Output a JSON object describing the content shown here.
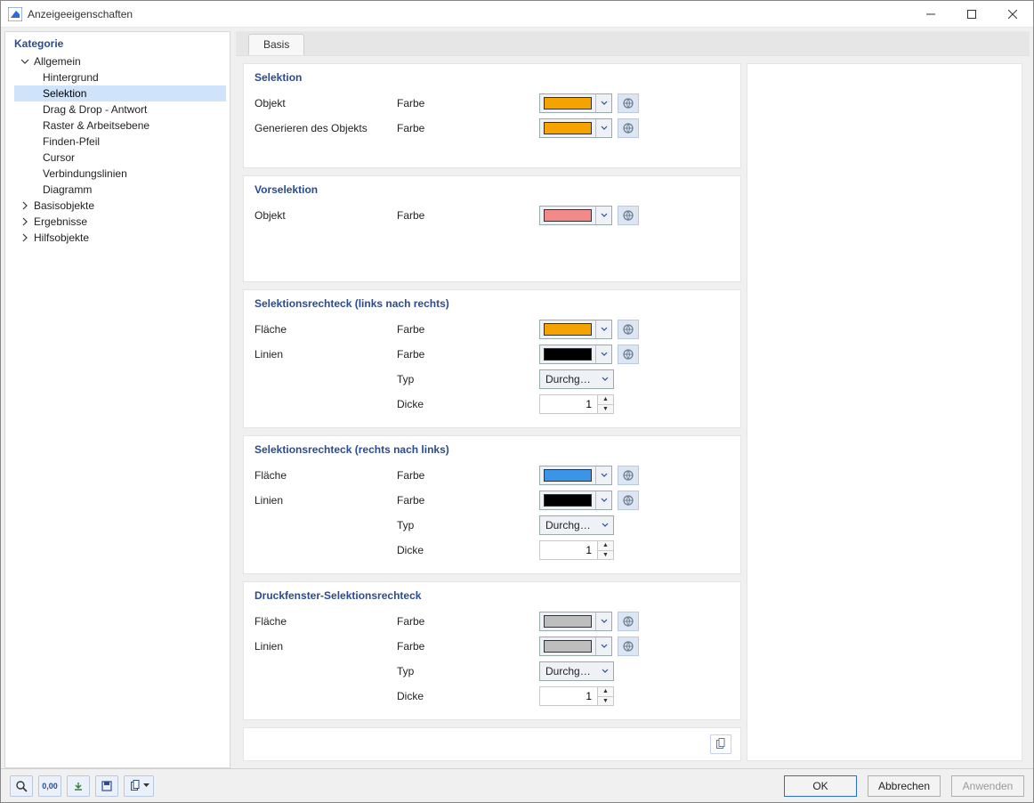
{
  "window": {
    "title": "Anzeigeeigenschaften"
  },
  "sidebar": {
    "header": "Kategorie",
    "items": [
      {
        "label": "Allgemein",
        "expanded": true
      },
      {
        "label": "Hintergrund"
      },
      {
        "label": "Selektion",
        "selected": true
      },
      {
        "label": "Drag & Drop - Antwort"
      },
      {
        "label": "Raster & Arbeitsebene"
      },
      {
        "label": "Finden-Pfeil"
      },
      {
        "label": "Cursor"
      },
      {
        "label": "Verbindungslinien"
      },
      {
        "label": "Diagramm"
      },
      {
        "label": "Basisobjekte",
        "expanded": false
      },
      {
        "label": "Ergebnisse",
        "expanded": false
      },
      {
        "label": "Hilfsobjekte",
        "expanded": false
      }
    ]
  },
  "tabs": {
    "active": "Basis"
  },
  "labels": {
    "objekt": "Objekt",
    "generieren": "Generieren des Objekts",
    "farbe": "Farbe",
    "flaeche": "Fläche",
    "linien": "Linien",
    "typ": "Typ",
    "dicke": "Dicke"
  },
  "combo": {
    "durchgezogen": "Durchgezo…"
  },
  "groups": {
    "selektion": {
      "title": "Selektion",
      "objekt_color": "#F5A300",
      "generieren_color": "#F5A300"
    },
    "vorselektion": {
      "title": "Vorselektion",
      "objekt_color": "#F28A8A"
    },
    "rect_lr": {
      "title": "Selektionsrechteck (links nach rechts)",
      "flaeche_color": "#F5A300",
      "linien_color": "#000000",
      "typ": "Durchgezo…",
      "dicke": "1"
    },
    "rect_rl": {
      "title": "Selektionsrechteck (rechts nach links)",
      "flaeche_color": "#3A95E8",
      "linien_color": "#000000",
      "typ": "Durchgezo…",
      "dicke": "1"
    },
    "print": {
      "title": "Druckfenster-Selektionsrechteck",
      "flaeche_color": "#BEBEBE",
      "linien_color": "#BEBEBE",
      "typ": "Durchgezo…",
      "dicke": "1"
    }
  },
  "footer": {
    "ok": "OK",
    "cancel": "Abbrechen",
    "apply": "Anwenden"
  }
}
